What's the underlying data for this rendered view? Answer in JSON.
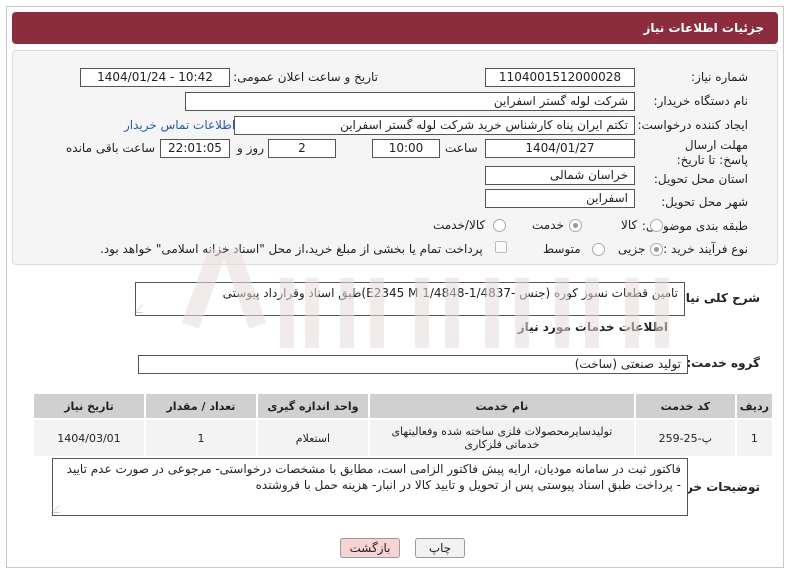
{
  "header": {
    "title": "جزئیات اطلاعات نیاز"
  },
  "form": {
    "need_number_label": "شماره نیاز:",
    "need_number": "1104001512000028",
    "announce_label": "تاریخ و ساعت اعلان عمومی:",
    "announce_value": "1404/01/24 - 10:42",
    "buyer_org_label": "نام دستگاه خریدار:",
    "buyer_org": "شرکت لوله گستر اسفراین",
    "creator_label": "ایجاد کننده درخواست:",
    "creator": "تکتم ایران پناه کارشناس خرید شرکت لوله گستر اسفراین",
    "buyer_contact_link": "اطلاعات تماس خریدار",
    "deadline_label": "مهلت ارسال پاسخ: تا تاریخ:",
    "deadline_date": "1404/01/27",
    "hour_label": "ساعت",
    "deadline_time": "10:00",
    "days_value": "2",
    "days_label": "روز و",
    "remaining_time": "22:01:05",
    "remaining_label": "ساعت باقی مانده",
    "province_label": "استان محل تحویل:",
    "province": "خراسان شمالی",
    "city_label": "شهر محل تحویل:",
    "city": "اسفراین",
    "category_label": "طبقه بندی موضوعی:",
    "category_options": [
      "کالا",
      "خدمت",
      "کالا/خدمت"
    ],
    "category_selected": "خدمت",
    "process_label": "نوع فرآیند خرید :",
    "process_options": [
      "جزیی",
      "متوسط"
    ],
    "process_selected": "جزیی",
    "payment_note": "پرداخت تمام یا بخشی از مبلغ خرید،از محل \"اسناد خزانه اسلامی\" خواهد بود."
  },
  "summary": {
    "label": "شرح کلی نیاز:",
    "text": "تامین قطعات نسوز کوره (جنس -1/4837-1/4848 E2345 M)طبق اسناد وقرارداد پیوستی"
  },
  "services": {
    "section_title": "اطلاعات خدمات مورد نیاز",
    "group_label": "گروه خدمت:",
    "group_value": "تولید صنعتی (ساخت)",
    "columns": [
      "ردیف",
      "کد خدمت",
      "نام خدمت",
      "واحد اندازه گیری",
      "تعداد / مقدار",
      "تاریخ نیاز"
    ],
    "rows": [
      {
        "index": "1",
        "code": "پ-25-259",
        "name": "تولیدسایرمحصولات فلزی ساخته شده وفعالیتهای خدماتی فلزکاری",
        "unit": "استعلام",
        "qty": "1",
        "date": "1404/03/01"
      }
    ]
  },
  "buyer_notes": {
    "label": "توضیحات خریدار:",
    "text": "فاکتور ثبت در سامانه مودیان، ارایه پیش فاکتور الزامی است، مطابق با مشخصات درخواستی- مرجوعی در صورت عدم تایید - پرداخت طبق اسناد پیوستی پس از تحویل و تایید کالا در انبار- هزینه حمل با فروشنده"
  },
  "actions": {
    "print_label": "چاپ",
    "back_label": "بازگشت"
  },
  "colors": {
    "header": "#8b2d3d",
    "link": "#2a5db0",
    "back_button": "#f7d4d4"
  }
}
